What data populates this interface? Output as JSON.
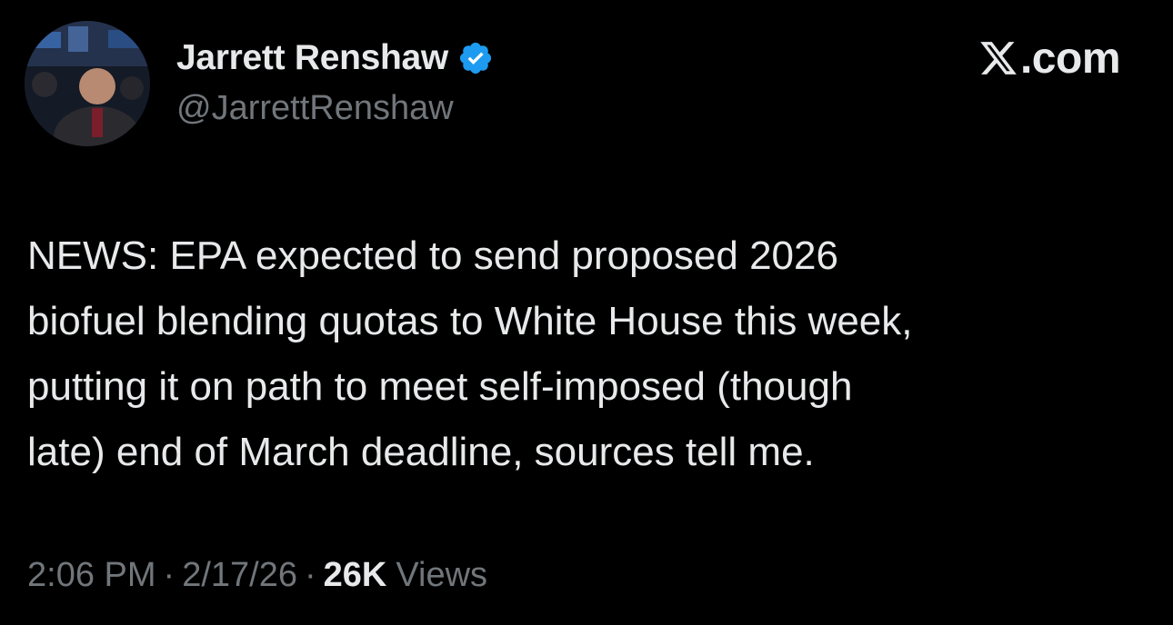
{
  "author": {
    "display_name": "Jarrett Renshaw",
    "handle": "@JarrettRenshaw",
    "verified": true,
    "verified_color": "#1d9bf0"
  },
  "brand": {
    "icon": "x-logo-icon",
    "text": ".com"
  },
  "post": {
    "lines": [
      "NEWS: EPA expected to send proposed 2026",
      "biofuel blending quotas to White House this week,",
      "putting it on path to meet self-imposed (though",
      "late) end of March deadline, sources tell me."
    ]
  },
  "meta": {
    "time": "2:06 PM",
    "separator": "·",
    "date": "2/17/26",
    "views_count": "26K",
    "views_label": "Views"
  },
  "colors": {
    "background": "#000000",
    "primary_text": "#e7e9ea",
    "secondary_text": "#71767b"
  }
}
